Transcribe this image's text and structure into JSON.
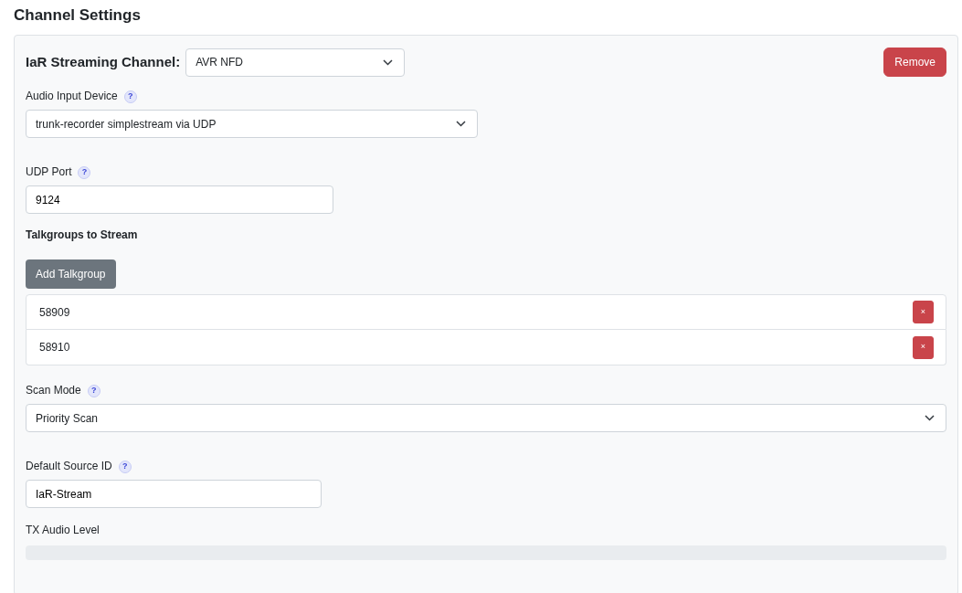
{
  "title": "Channel Settings",
  "channel": {
    "label": "IaR Streaming Channel:",
    "value": "AVR NFD",
    "remove": "Remove"
  },
  "fields": [
    {
      "kind": "select",
      "label": "Audio Input Device",
      "help": "?",
      "value": "trunk-recorder simplestream via UDP"
    },
    {
      "kind": "text",
      "label": "UDP Port",
      "help": "?",
      "value": "9124"
    },
    {
      "kind": "talkgroups",
      "label": "Talkgroups to Stream",
      "button": "Add Talkgroup",
      "items": [
        {
          "value": "58909",
          "remove": "×"
        },
        {
          "value": "58910",
          "remove": "×"
        }
      ]
    },
    {
      "kind": "select",
      "label": "Scan Mode",
      "help": "?",
      "value": "Priority Scan"
    },
    {
      "kind": "text",
      "label": "Default Source ID",
      "help": "?",
      "value": "IaR-Stream"
    },
    {
      "kind": "meter",
      "label": "TX Audio Level",
      "level": 0
    }
  ]
}
